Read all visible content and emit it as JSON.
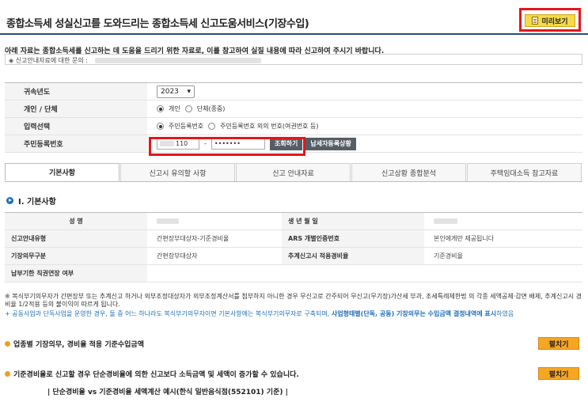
{
  "header": {
    "title": "종합소득세 성실신고를 도와드리는 종합소득세 신고도움서비스(기장수입)",
    "preview_label": "미리보기"
  },
  "notice": "아래 자료는 종합소득세를 신고하는 데 도움을 드리기 위한 자료로, 이를 참고하여 실질 내용에 따라 신고하여 주시기 바랍니다.",
  "inquiry_label": "◈ 신고안내자료에 대한 문의 :",
  "form": {
    "year_label": "귀속년도",
    "year_value": "2023",
    "type_label": "개인 / 단체",
    "type_options": [
      "개인",
      "단체(종중)"
    ],
    "input_label": "입력선택",
    "input_options": [
      "주민등록번호",
      "주민등록번호 외의 번호(여권번호 등)"
    ],
    "jumin_label": "주민등록번호",
    "jumin_front": "110",
    "jumin_sep": "-",
    "jumin_back": "•••••••",
    "lookup_button": "조회하기",
    "taxpayer_status_button": "납세자등록상황"
  },
  "tabs": [
    "기본사항",
    "신고시 유의할 사항",
    "신고 안내자료",
    "신고상황 종합분석",
    "주택임대소득 참고자료"
  ],
  "section_title": "Ⅰ. 기본사항",
  "info": {
    "name_label": "성          명",
    "birth_label": "생 년 월 일",
    "guide_type_label": "신고안내유형",
    "guide_type_value": "간편장부대상자-기준경비율",
    "ars_label": "ARS 개별인증번호",
    "ars_value": "본인에게만 제공됩니다",
    "duty_label": "기장의무구분",
    "duty_value": "간편장부대상자",
    "rate_label": "추계신고시 적용경비율",
    "rate_value": "기준경비율",
    "site_label": "납부기한 직권연장 여부"
  },
  "footnote1": "※ 복식부기의무자가 간편장부 또는 추계신고 하거나 외부조정대상자가 외부조정계산서를 첨부하지 아니한 경우 무신고로 간주되어 무신고(무기장)가산세 부과, 조세특례제한법 의 각종 세액공제·감면 배제, 추계신고시 경비율 1/2적용 등의 불이익이 따르게 됩니다.",
  "footnote2_a": "+ 공동사업과 단독사업을 운영한 경우, 둘 중 어느 하나라도 복식부기의무자이면 기본사항에는 복식부기의무자로 구축되며,",
  "footnote2_b": "사업형태별(단독, 공동) 기장의무는 수입금액 결정내역에 표시",
  "footnote2_c": "하였음",
  "expand1_label": "업종별 기장의무, 경비율 적용 기준수입금액",
  "expand2_label": "기준경비율로 신고할 경우 단순경비율에 의한 신고보다 소득금액 및 세액이 증가할 수 있습니다.",
  "expand_button": "펼치기",
  "example_caption": "| 단순경비율 vs 기준경비율 세액계산 예시(한식 일반음식점(552101) 기준) |"
}
